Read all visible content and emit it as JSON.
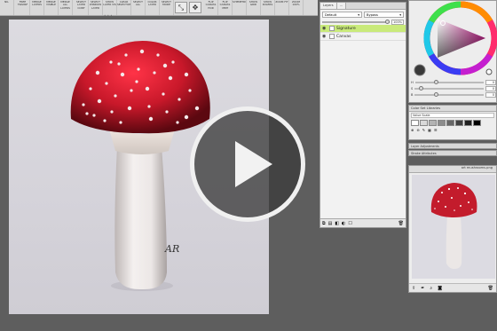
{
  "toolbar": {
    "buttons": [
      "NIL",
      "FREE TRANSF",
      "MERGE LAYERS",
      "MERGE VISIBLE",
      "MERGE ALL LAYERS",
      "SELECT LAYER CONT",
      "SELECT WINDOW LAYER",
      "SHOW LAYER VIS",
      "CLEAR SELECTION",
      "SELECT ALL",
      "COLOR LAYER",
      "SELECT MODE",
      "FLIP CANVAS HOR",
      "FLIP CANVAS VERT",
      "SYMMETRY",
      "SHOW GRID",
      "SHOW RULERS",
      "ZOOM FIT",
      "ZOOM 100%"
    ]
  },
  "layers": {
    "tabs": [
      "Layers",
      "..."
    ],
    "blend_mode": "Default",
    "preset": "Bypass",
    "opacity_value": "100%",
    "rows": [
      {
        "name": "Signature",
        "active": true
      },
      {
        "name": "Canvas",
        "active": false
      }
    ]
  },
  "color": {
    "sliders": [
      {
        "label": "H",
        "value": "0",
        "level": 0.28
      },
      {
        "label": "S",
        "value": "0",
        "level": 0.06
      },
      {
        "label": "B",
        "value": "0",
        "level": 0.28
      }
    ],
    "primary": "#d41d38",
    "wheel_triangle": "#c31f8a"
  },
  "color_set": {
    "header": "Color Set Libraries",
    "name": "Value Scale",
    "swatches": [
      "#ffffff",
      "#d9d9d9",
      "#b3b3b3",
      "#8c8c8c",
      "#666666",
      "#404040",
      "#202020",
      "#000000"
    ]
  },
  "side_tabs": [
    "Layer Adjustments",
    "Stroke Attributes"
  ],
  "navigator": {
    "title": "art mushrooms.png"
  },
  "artwork": {
    "signature": "AR",
    "cap_color": "#c8182a",
    "stem_color": "#e8e4e3"
  },
  "overlay": {
    "play_icon": "play-icon"
  }
}
